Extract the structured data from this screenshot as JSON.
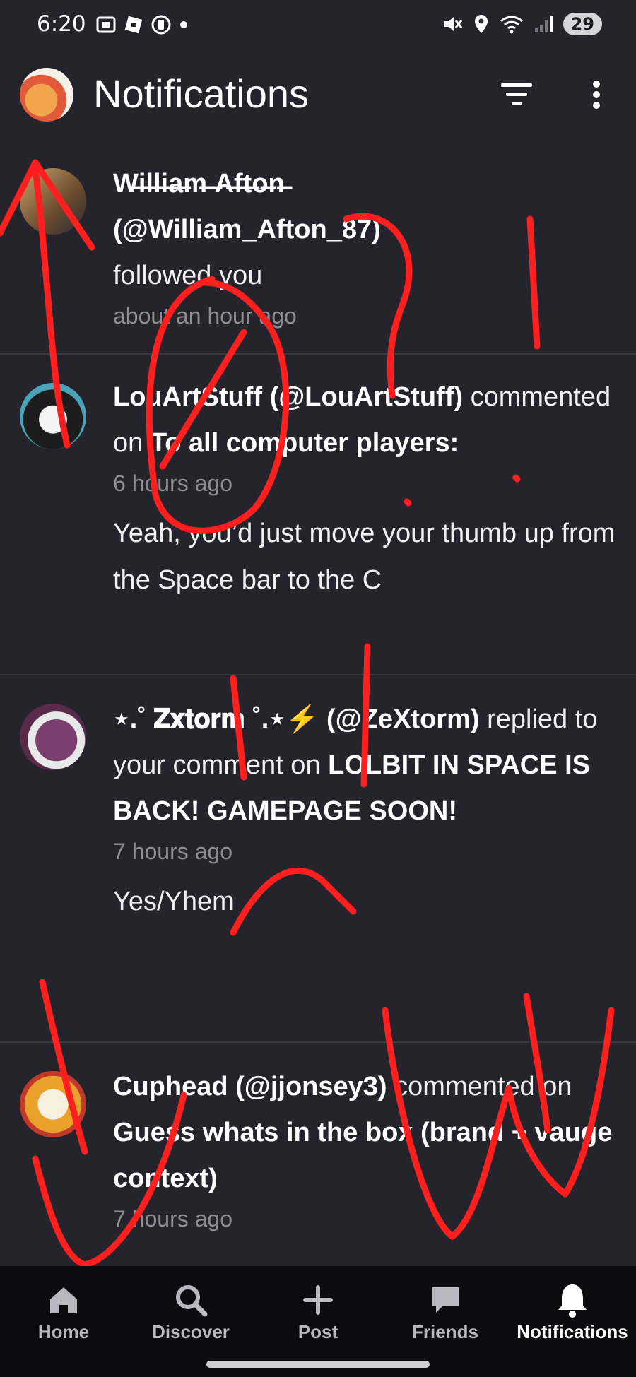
{
  "status_bar": {
    "time": "6:20",
    "battery": "29",
    "left_icons": [
      "screenshot-icon",
      "roblox-icon",
      "timer-icon",
      "dot-icon"
    ],
    "right_icons": [
      "mute-icon",
      "location-icon",
      "wifi-icon",
      "signal-icon"
    ]
  },
  "header": {
    "title": "Notifications",
    "filter_icon": "filter-icon",
    "more_icon": "more-vertical-icon"
  },
  "notifications": [
    {
      "name": "W̶i̶l̶l̶i̶a̶m̶ ̶A̶f̶t̶o̶n̶",
      "handle": "(@William_Afton_87)",
      "action": "followed you",
      "target": "",
      "time": "about an hour ago",
      "snippet": ""
    },
    {
      "name": "LouArtStuff (@LouArtStuff)",
      "handle": "",
      "action": "commented on",
      "target": "To all computer players:",
      "time": "6 hours ago",
      "snippet": "Yeah, you’d just move your thumb up from the Space bar to the C"
    },
    {
      "name": "⋆.˚ 𝐙𝐱𝐭𝐨𝐫𝐦 ˚.⋆⚡",
      "handle": "(@ZeXtorm)",
      "action": "replied to your comment on",
      "target": "LOLBIT IN SPACE IS BACK! GAMEPAGE SOON!",
      "time": "7 hours ago",
      "snippet": "Yes/Yhem"
    },
    {
      "name": "Cuphead (@jjonsey3)",
      "handle": "",
      "action": "commented on",
      "target": "Guess whats in the box (brand + vauge context)",
      "time": "7 hours ago",
      "snippet": ""
    }
  ],
  "bottom_nav": [
    {
      "label": "Home",
      "icon": "home-icon"
    },
    {
      "label": "Discover",
      "icon": "search-icon"
    },
    {
      "label": "Post",
      "icon": "plus-icon"
    },
    {
      "label": "Friends",
      "icon": "chat-icon"
    },
    {
      "label": "Notifications",
      "icon": "bell-icon"
    }
  ],
  "colors": {
    "background": "#25242c",
    "divider": "#3a3942",
    "muted_text": "#8f8e96",
    "nav_background": "#0c0c0e",
    "scribble": "#ff1f1f"
  }
}
